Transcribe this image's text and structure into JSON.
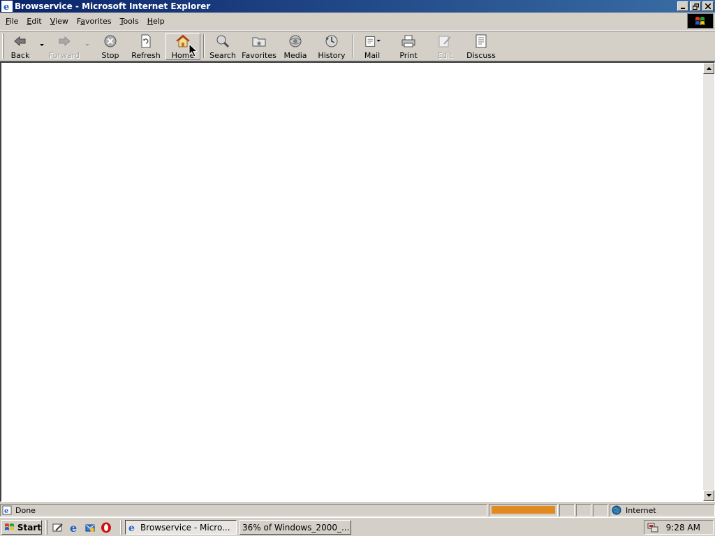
{
  "window": {
    "title": "Browservice - Microsoft Internet Explorer"
  },
  "menu": [
    {
      "pre": "",
      "ul": "F",
      "post": "ile"
    },
    {
      "pre": "",
      "ul": "E",
      "post": "dit"
    },
    {
      "pre": "",
      "ul": "V",
      "post": "iew"
    },
    {
      "pre": "F",
      "ul": "a",
      "post": "vorites"
    },
    {
      "pre": "",
      "ul": "T",
      "post": "ools"
    },
    {
      "pre": "",
      "ul": "H",
      "post": "elp"
    }
  ],
  "toolbar": {
    "back": "Back",
    "forward": "Forward",
    "stop": "Stop",
    "refresh": "Refresh",
    "home": "Home",
    "search": "Search",
    "favorites": "Favorites",
    "media": "Media",
    "history": "History",
    "mail": "Mail",
    "print": "Print",
    "edit": "Edit",
    "discuss": "Discuss"
  },
  "status": {
    "text": "Done",
    "zone": "Internet",
    "progress_percent": 100
  },
  "taskbar": {
    "start": "Start",
    "tasks": [
      {
        "label": "Browservice - Micro...",
        "active": true
      },
      {
        "label": "36% of Windows_2000_...",
        "active": false
      }
    ],
    "clock": "9:28 AM"
  },
  "colors": {
    "titlebar_start": "#0a246a",
    "titlebar_end": "#3a6ea5",
    "progress": "#e08a20",
    "chrome": "#d4d0c8"
  }
}
